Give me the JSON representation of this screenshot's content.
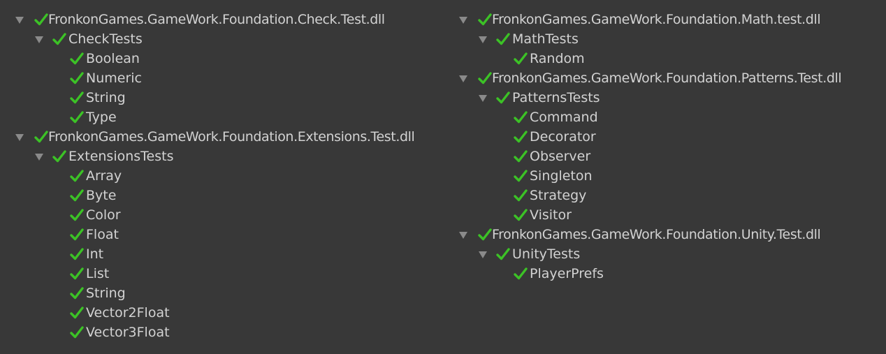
{
  "colors": {
    "background": "#383838",
    "text": "#d2d2d2",
    "check": "#3cc226",
    "arrow": "#8a8a8a"
  },
  "icons": {
    "expanded": "triangle-down-icon",
    "passed": "checkmark-icon"
  },
  "left": {
    "check_dll": "FronkonGames.GameWork.Foundation.Check.Test.dll",
    "check_tests": "CheckTests",
    "check_items": [
      "Boolean",
      "Numeric",
      "String",
      "Type"
    ],
    "extensions_dll": "FronkonGames.GameWork.Foundation.Extensions.Test.dll",
    "extensions_tests": "ExtensionsTests",
    "extensions_items": [
      "Array",
      "Byte",
      "Color",
      "Float",
      "Int",
      "List",
      "String",
      "Vector2Float",
      "Vector3Float"
    ]
  },
  "right": {
    "math_dll": "FronkonGames.GameWork.Foundation.Math.test.dll",
    "math_tests": "MathTests",
    "math_items": [
      "Random"
    ],
    "patterns_dll": "FronkonGames.GameWork.Foundation.Patterns.Test.dll",
    "patterns_tests": "PatternsTests",
    "patterns_items": [
      "Command",
      "Decorator",
      "Observer",
      "Singleton",
      "Strategy",
      "Visitor"
    ],
    "unity_dll": "FronkonGames.GameWork.Foundation.Unity.Test.dll",
    "unity_tests": "UnityTests",
    "unity_items": [
      "PlayerPrefs"
    ]
  }
}
